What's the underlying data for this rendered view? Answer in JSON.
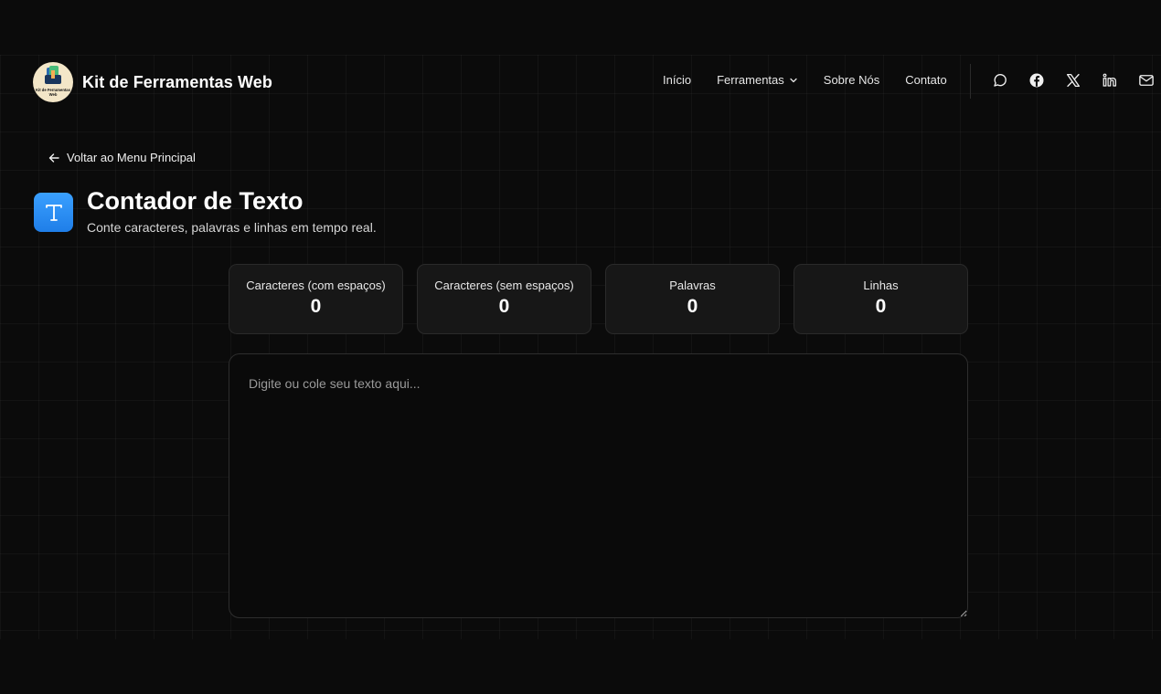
{
  "header": {
    "brand_name": "Kit de Ferramentas Web",
    "logo_text": "Kit de Ferramentas Web",
    "nav": [
      {
        "label": "Início"
      },
      {
        "label": "Ferramentas"
      },
      {
        "label": "Sobre Nós"
      },
      {
        "label": "Contato"
      }
    ],
    "socials": [
      "chat-icon",
      "facebook-icon",
      "x-icon",
      "linkedin-icon",
      "mail-icon"
    ]
  },
  "back_link": {
    "label": "Voltar ao Menu Principal"
  },
  "tool": {
    "icon_letter": "T",
    "title": "Contador de Texto",
    "subtitle": "Conte caracteres, palavras e linhas em tempo real."
  },
  "stats": [
    {
      "label": "Caracteres (com espaços)",
      "value": "0"
    },
    {
      "label": "Caracteres (sem espaços)",
      "value": "0"
    },
    {
      "label": "Palavras",
      "value": "0"
    },
    {
      "label": "Linhas",
      "value": "0"
    }
  ],
  "editor": {
    "placeholder": "Digite ou cole seu texto aqui...",
    "value": ""
  },
  "colors": {
    "background": "#0b0b0b",
    "card": "#171717",
    "accent": "#2b8cf5"
  }
}
